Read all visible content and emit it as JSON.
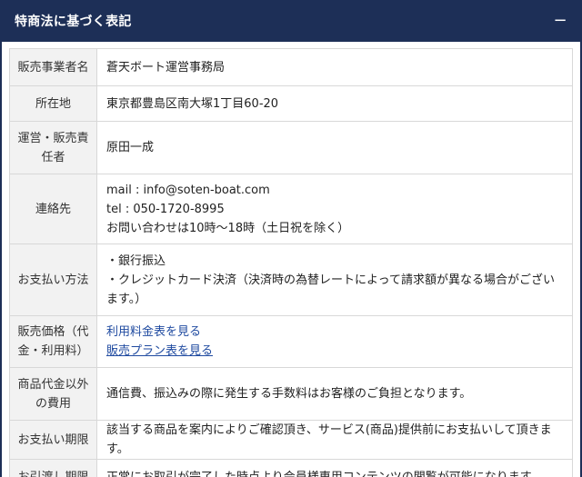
{
  "panel": {
    "title": "特商法に基づく表記",
    "toggle_symbol": "−"
  },
  "rows": [
    {
      "label": "販売事業者名",
      "value": "蒼天ボート運営事務局"
    },
    {
      "label": "所在地",
      "value": "東京都豊島区南大塚1丁目60-20"
    },
    {
      "label": "運営・販売責任者",
      "value": "原田一成"
    },
    {
      "label": "連絡先",
      "lines": [
        "mail : info@soten-boat.com",
        "tel : 050-1720-8995",
        "お問い合わせは10時〜18時（土日祝を除く）"
      ]
    },
    {
      "label": "お支払い方法",
      "lines": [
        "・銀行振込",
        "・クレジットカード決済（決済時の為替レートによって請求額が異なる場合がございます。）"
      ]
    },
    {
      "label": "販売価格（代金・利用料）",
      "links": [
        "利用料金表を見る",
        "販売プラン表を見る"
      ]
    },
    {
      "label": "商品代金以外の費用",
      "value": "通信費、振込みの際に発生する手数料はお客様のご負担となります。"
    },
    {
      "label": "お支払い期限",
      "value": "該当する商品を案内によりご確認頂き、サービス(商品)提供前にお支払いして頂きます。"
    },
    {
      "label": "お引渡し期限",
      "value": "正常にお取引が完了した時点より会員様専用コンテンツの閲覧が可能になります。"
    }
  ]
}
